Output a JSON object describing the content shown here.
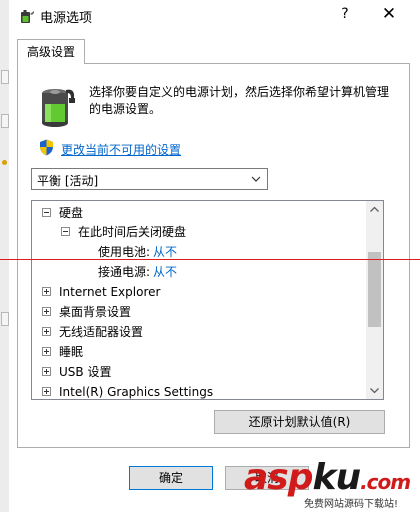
{
  "window": {
    "title": "电源选项",
    "help_label": "?",
    "close_label": "✕"
  },
  "tab": {
    "label": "高级设置"
  },
  "description": "选择你要自定义的电源计划，然后选择你希望计算机管理的电源设置。",
  "change_link": "更改当前不可用的设置",
  "plan_select": {
    "value": "平衡 [活动]"
  },
  "tree": {
    "hard_disk": "硬盘",
    "turn_off_after": "在此时间后关闭硬盘",
    "on_battery_label": "使用电池:",
    "on_battery_value": "从不",
    "plugged_in_label": "接通电源:",
    "plugged_in_value": "从不",
    "items": [
      "Internet Explorer",
      "桌面背景设置",
      "无线适配器设置",
      "睡眠",
      "USB 设置",
      "Intel(R) Graphics Settings"
    ]
  },
  "buttons": {
    "restore": "还原计划默认值(R)",
    "ok": "确定",
    "cancel": "取消"
  },
  "watermark": {
    "logo_main": "asp",
    "logo_accent": "ku",
    "logo_tail": ".com",
    "sub": "免费网站源码下载站!"
  },
  "colors": {
    "link": "#0066cc",
    "accent_border": "#0078d7",
    "annotation_line": "#e31b1b",
    "watermark": "#d11a1a"
  },
  "icons": {
    "app": "battery-plug-icon",
    "battery": "battery-icon",
    "shield": "uac-shield-icon"
  }
}
